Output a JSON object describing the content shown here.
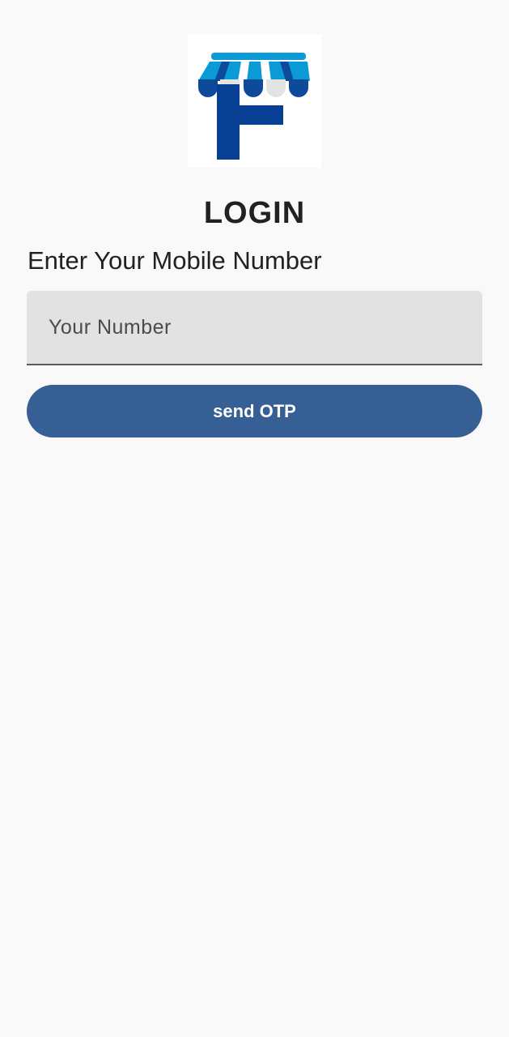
{
  "logo": {
    "icon": "storefront-awning-f-logo",
    "colors": {
      "awning_light_blue": "#0a9bd6",
      "awning_dark_blue": "#0d4a9c",
      "awning_white": "#e3e3e3",
      "letter_navy": "#063f93"
    }
  },
  "header": {
    "title": "LOGIN"
  },
  "form": {
    "prompt": "Enter Your Mobile Number",
    "number_placeholder": "Your Number",
    "number_value": "",
    "send_otp_label": "send OTP"
  },
  "theme": {
    "background": "#f9f9f9",
    "button_color": "#365f96",
    "field_background": "#e2e2e2"
  }
}
